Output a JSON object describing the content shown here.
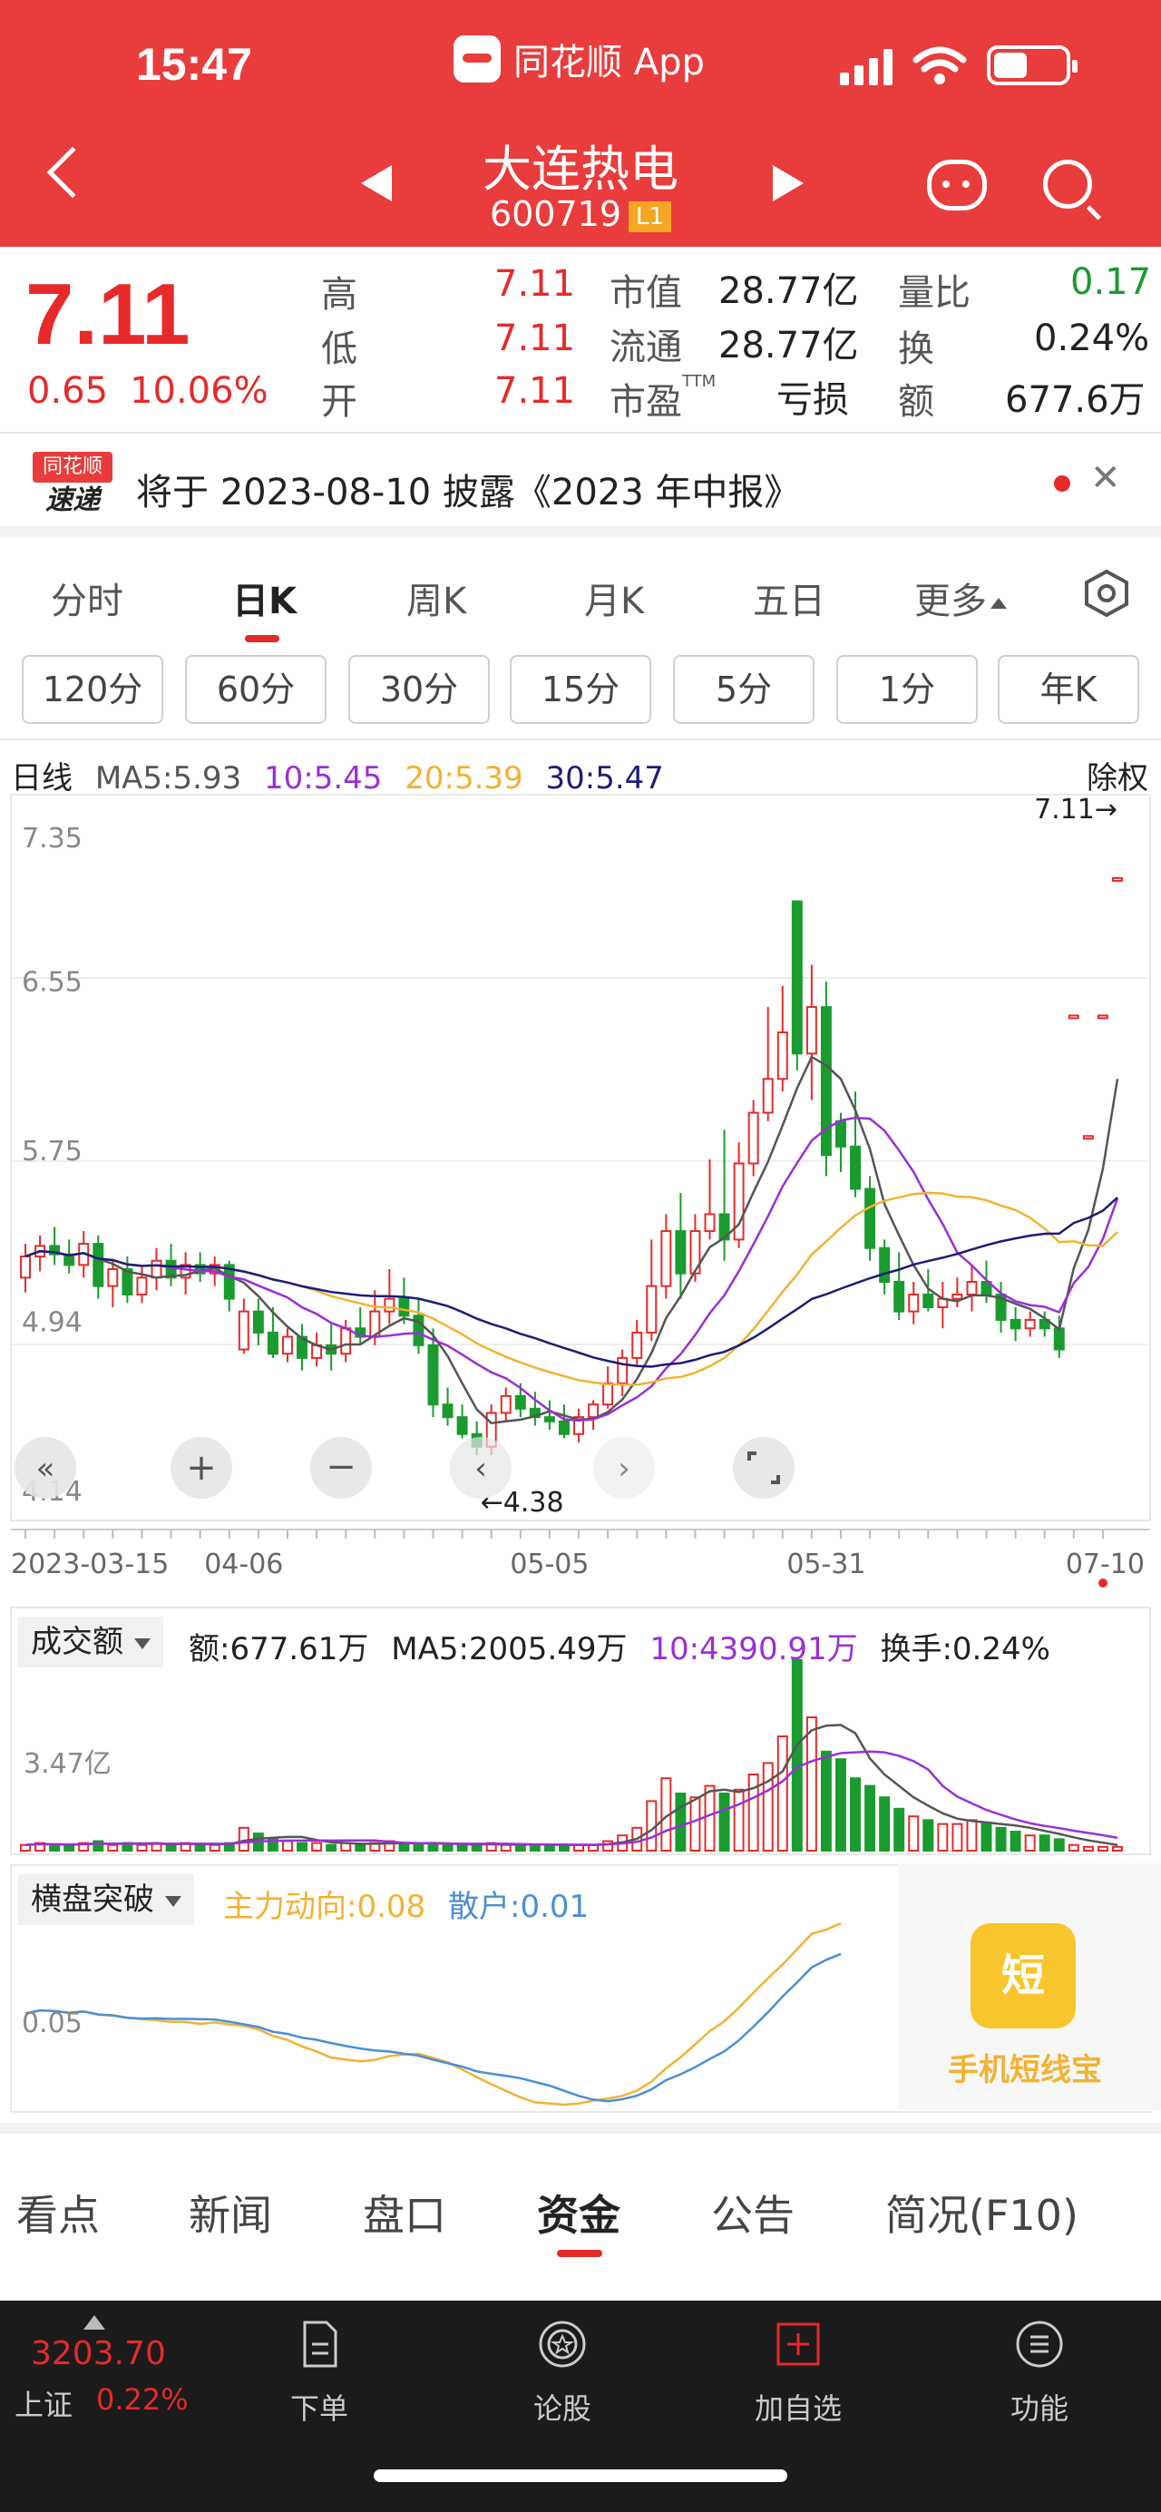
{
  "status_bar": {
    "time": "15:47",
    "app_name": "同花顺 App"
  },
  "header": {
    "stock_name": "大连热电",
    "stock_code": "600719",
    "level_badge": "L1"
  },
  "quote": {
    "last_price": "7.11",
    "change": "0.65",
    "change_pct": "10.06%",
    "high_label": "高",
    "high": "7.11",
    "low_label": "低",
    "low": "7.11",
    "open_label": "开",
    "open": "7.11",
    "mcap_label": "市值",
    "mcap": "28.77亿",
    "float_label": "流通",
    "float": "28.77亿",
    "pe_label": "市盈",
    "pe_sup": "TTM",
    "pe": "亏损",
    "vr_label": "量比",
    "vr": "0.17",
    "turnover_label": "换",
    "turnover": "0.24%",
    "amount_label": "额",
    "amount": "677.6万"
  },
  "notice": {
    "logo_top": "同花顺",
    "logo_bottom": "速递",
    "text": "将于 2023-08-10 披露《2023 年中报》"
  },
  "period_tabs": [
    "分时",
    "日K",
    "周K",
    "月K",
    "五日",
    "更多"
  ],
  "minute_buttons": [
    "120分",
    "60分",
    "30分",
    "15分",
    "5分",
    "1分",
    "年K"
  ],
  "ma_bar": {
    "label": "日线",
    "ma5": "MA5:5.93",
    "ma10": "10:5.45",
    "ma20": "20:5.39",
    "ma30": "30:5.47",
    "right": "除权"
  },
  "price_axis": [
    "7.35",
    "6.55",
    "5.75",
    "4.94",
    "4.14"
  ],
  "price_marks": {
    "last": "7.11→",
    "low": "←4.38"
  },
  "date_axis": [
    "2023-03-15",
    "04-06",
    "05-05",
    "05-31",
    "07-10"
  ],
  "volume": {
    "dropdown": "成交额",
    "amount": "额:677.61万",
    "ma5": "MA5:2005.49万",
    "ma10": "10:4390.91万",
    "turnover": "换手:0.24%",
    "axis_label": "3.47亿"
  },
  "indicator": {
    "dropdown": "横盘突破",
    "main": "主力动向:0.08",
    "retail": "散户:0.01",
    "axis_label": "0.05"
  },
  "promo": {
    "icon": "短",
    "text": "手机短线宝"
  },
  "content_tabs": [
    "看点",
    "新闻",
    "盘口",
    "资金",
    "公告",
    "简况(F10)"
  ],
  "bottom_bar": {
    "index_value": "3203.70",
    "index_name": "上证",
    "index_pct": "0.22%",
    "nav": [
      "下单",
      "论股",
      "加自选",
      "功能"
    ]
  },
  "colors": {
    "up": "#e62a2a",
    "down": "#1a9b2f",
    "ma5": "#555555",
    "ma10": "#9b2fd6",
    "ma20": "#f2b233",
    "ma30": "#1c1c7a",
    "main_force": "#f2b233",
    "retail": "#4a8fd6"
  },
  "chart_data": {
    "type": "candlestick",
    "price_axis_ticks": [
      7.35,
      6.55,
      5.75,
      4.94,
      4.14
    ],
    "ylim": [
      4.14,
      7.35
    ],
    "dates_labeled": [
      "2023-03-15",
      "04-06",
      "05-05",
      "05-31",
      "07-10"
    ],
    "candles": [
      [
        5.22,
        5.38,
        5.15,
        5.32
      ],
      [
        5.32,
        5.42,
        5.25,
        5.37
      ],
      [
        5.37,
        5.46,
        5.28,
        5.33
      ],
      [
        5.33,
        5.4,
        5.24,
        5.28
      ],
      [
        5.28,
        5.44,
        5.22,
        5.38
      ],
      [
        5.38,
        5.42,
        5.12,
        5.18
      ],
      [
        5.18,
        5.3,
        5.08,
        5.26
      ],
      [
        5.26,
        5.32,
        5.1,
        5.14
      ],
      [
        5.14,
        5.28,
        5.1,
        5.22
      ],
      [
        5.22,
        5.36,
        5.16,
        5.3
      ],
      [
        5.3,
        5.38,
        5.18,
        5.22
      ],
      [
        5.22,
        5.34,
        5.14,
        5.28
      ],
      [
        5.28,
        5.34,
        5.2,
        5.24
      ],
      [
        5.24,
        5.32,
        5.18,
        5.28
      ],
      [
        5.28,
        5.3,
        5.06,
        5.12
      ],
      [
        4.88,
        5.12,
        4.86,
        5.06
      ],
      [
        5.06,
        5.12,
        4.9,
        4.96
      ],
      [
        4.96,
        5.08,
        4.84,
        4.86
      ],
      [
        4.86,
        4.98,
        4.82,
        4.94
      ],
      [
        4.94,
        5.0,
        4.78,
        4.84
      ],
      [
        4.84,
        4.96,
        4.8,
        4.9
      ],
      [
        4.9,
        5.0,
        4.78,
        4.86
      ],
      [
        4.86,
        5.02,
        4.82,
        4.98
      ],
      [
        4.98,
        5.08,
        4.9,
        4.94
      ],
      [
        4.94,
        5.16,
        4.9,
        5.06
      ],
      [
        5.06,
        5.26,
        5.0,
        5.12
      ],
      [
        5.12,
        5.22,
        5.0,
        5.04
      ],
      [
        5.04,
        5.12,
        4.86,
        4.9
      ],
      [
        4.9,
        4.98,
        4.56,
        4.62
      ],
      [
        4.62,
        4.7,
        4.52,
        4.56
      ],
      [
        4.56,
        4.62,
        4.46,
        4.48
      ],
      [
        4.48,
        4.54,
        4.38,
        4.42
      ],
      [
        4.42,
        4.62,
        4.38,
        4.58
      ],
      [
        4.58,
        4.7,
        4.54,
        4.66
      ],
      [
        4.66,
        4.72,
        4.56,
        4.6
      ],
      [
        4.6,
        4.68,
        4.52,
        4.56
      ],
      [
        4.56,
        4.64,
        4.5,
        4.54
      ],
      [
        4.54,
        4.62,
        4.46,
        4.48
      ],
      [
        4.48,
        4.6,
        4.44,
        4.56
      ],
      [
        4.56,
        4.64,
        4.5,
        4.62
      ],
      [
        4.62,
        4.8,
        4.6,
        4.72
      ],
      [
        4.72,
        4.88,
        4.66,
        4.84
      ],
      [
        4.84,
        5.02,
        4.8,
        4.96
      ],
      [
        4.96,
        5.4,
        4.92,
        5.18
      ],
      [
        5.18,
        5.52,
        5.12,
        5.44
      ],
      [
        5.44,
        5.62,
        5.12,
        5.24
      ],
      [
        5.24,
        5.52,
        5.2,
        5.44
      ],
      [
        5.44,
        5.78,
        5.4,
        5.52
      ],
      [
        5.52,
        5.92,
        5.3,
        5.4
      ],
      [
        5.4,
        5.86,
        5.36,
        5.76
      ],
      [
        5.76,
        6.06,
        5.7,
        6.0
      ],
      [
        6.0,
        6.5,
        5.96,
        6.16
      ],
      [
        6.16,
        6.6,
        6.1,
        6.38
      ],
      [
        7.0,
        7.0,
        6.2,
        6.28
      ],
      [
        6.28,
        6.7,
        6.06,
        6.5
      ],
      [
        6.5,
        6.62,
        5.7,
        5.8
      ],
      [
        5.96,
        6.0,
        5.72,
        5.84
      ],
      [
        5.84,
        6.1,
        5.6,
        5.64
      ],
      [
        5.64,
        5.7,
        5.3,
        5.36
      ],
      [
        5.36,
        5.4,
        5.14,
        5.2
      ],
      [
        5.2,
        5.34,
        5.02,
        5.06
      ],
      [
        5.06,
        5.2,
        5.0,
        5.14
      ],
      [
        5.14,
        5.26,
        5.06,
        5.08
      ],
      [
        5.08,
        5.2,
        4.98,
        5.12
      ],
      [
        5.12,
        5.22,
        5.08,
        5.14
      ],
      [
        5.14,
        5.28,
        5.06,
        5.2
      ],
      [
        5.2,
        5.3,
        5.1,
        5.14
      ],
      [
        5.14,
        5.2,
        4.96,
        5.02
      ],
      [
        5.02,
        5.08,
        4.92,
        4.98
      ],
      [
        4.98,
        5.06,
        4.94,
        5.02
      ],
      [
        5.02,
        5.06,
        4.94,
        4.98
      ],
      [
        4.98,
        5.04,
        4.84,
        4.88
      ],
      [
        6.46,
        6.46,
        6.46,
        6.46
      ],
      [
        5.89,
        5.89,
        5.89,
        5.89
      ],
      [
        6.46,
        6.46,
        6.46,
        6.46
      ],
      [
        7.11,
        7.11,
        7.11,
        7.11
      ]
    ],
    "ma5_last": 5.93,
    "ma10_last": 5.45,
    "ma20_last": 5.39,
    "ma30_last": 5.47,
    "high_mark": 7.11,
    "low_mark": 4.38,
    "volume_ylabel_value": "3.47亿",
    "volume_relative": [
      0.03,
      0.04,
      0.03,
      0.03,
      0.04,
      0.05,
      0.03,
      0.04,
      0.03,
      0.04,
      0.03,
      0.04,
      0.03,
      0.03,
      0.04,
      0.12,
      0.09,
      0.06,
      0.05,
      0.04,
      0.04,
      0.03,
      0.04,
      0.03,
      0.04,
      0.05,
      0.04,
      0.03,
      0.04,
      0.03,
      0.03,
      0.03,
      0.04,
      0.03,
      0.03,
      0.03,
      0.03,
      0.03,
      0.03,
      0.03,
      0.05,
      0.08,
      0.12,
      0.26,
      0.38,
      0.3,
      0.28,
      0.34,
      0.3,
      0.32,
      0.4,
      0.46,
      0.6,
      1.0,
      0.7,
      0.52,
      0.48,
      0.38,
      0.34,
      0.28,
      0.22,
      0.18,
      0.16,
      0.14,
      0.14,
      0.16,
      0.14,
      0.12,
      0.1,
      0.08,
      0.08,
      0.06,
      0.03,
      0.02,
      0.02,
      0.02
    ]
  }
}
